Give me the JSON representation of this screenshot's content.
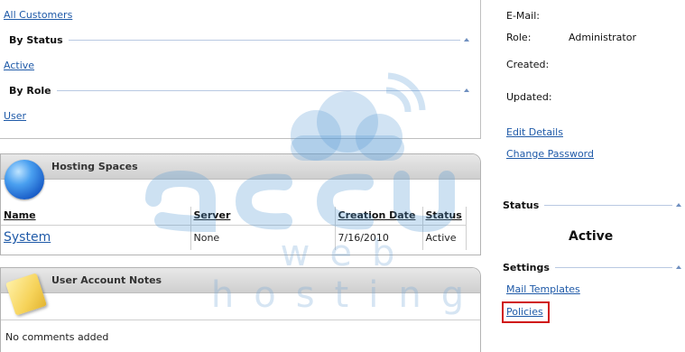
{
  "filters": {
    "all_customers": "All Customers",
    "by_status": "By Status",
    "active": "Active",
    "by_role": "By Role",
    "user": "User"
  },
  "hosting": {
    "title": "Hosting Spaces",
    "columns": [
      "Name",
      "Server",
      "Creation Date",
      "Status"
    ],
    "rows": [
      {
        "name": "System",
        "server": "None",
        "creation_date": "7/16/2010",
        "status": "Active"
      }
    ]
  },
  "notes": {
    "title": "User Account Notes",
    "empty": "No comments added"
  },
  "details": {
    "email_label": "E-Mail:",
    "role_label": "Role:",
    "role_value": "Administrator",
    "created_label": "Created:",
    "updated_label": "Updated:",
    "edit_details": "Edit Details",
    "change_password": "Change Password"
  },
  "status_section": {
    "title": "Status",
    "value": "Active"
  },
  "settings_section": {
    "title": "Settings",
    "mail_templates": "Mail Templates",
    "policies": "Policies"
  },
  "watermark": {
    "text": "web hosting",
    "colors": {
      "primary": "#5a9bd5"
    }
  },
  "colors": {
    "link": "#1f5aa8",
    "highlight": "#d01515"
  }
}
